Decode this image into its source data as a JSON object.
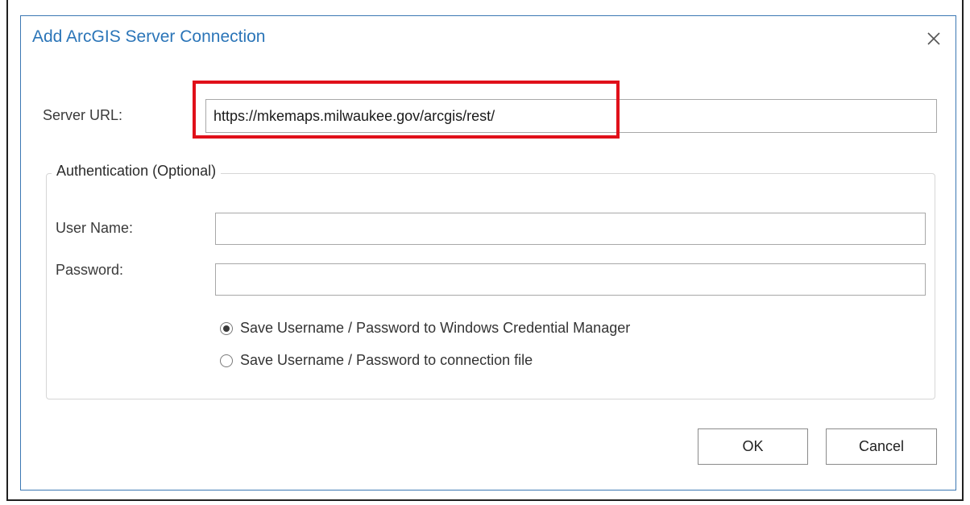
{
  "dialog": {
    "title": "Add ArcGIS Server Connection",
    "close_icon": "close-icon"
  },
  "server": {
    "label": "Server URL:",
    "value": "https://mkemaps.milwaukee.gov/arcgis/rest/"
  },
  "authentication": {
    "legend": "Authentication (Optional)",
    "username_label": "User Name:",
    "username_value": "",
    "password_label": "Password:",
    "password_value": "",
    "options": [
      {
        "label": "Save Username / Password to Windows Credential Manager",
        "selected": true
      },
      {
        "label": "Save Username / Password to connection file",
        "selected": false
      }
    ]
  },
  "buttons": {
    "ok": "OK",
    "cancel": "Cancel"
  },
  "colors": {
    "title": "#2b75b8",
    "highlight": "#e0101a",
    "dialog_border": "#3c78b4"
  }
}
